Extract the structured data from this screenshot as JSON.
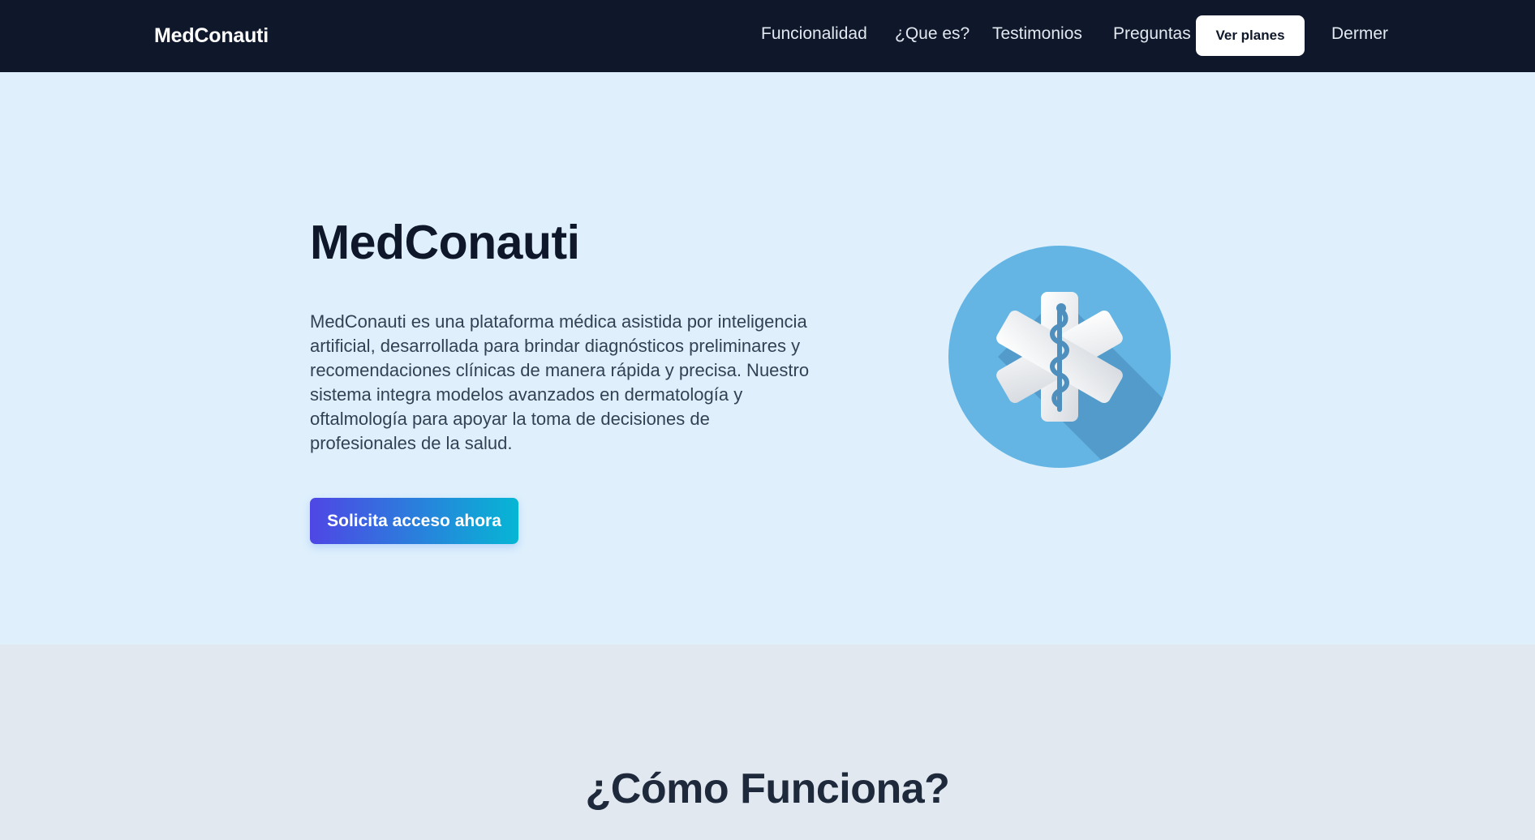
{
  "nav": {
    "brand": "MedConauti",
    "links": [
      "Funcionalidad",
      "¿Que es?",
      "Testimonios",
      "Preguntas"
    ],
    "cta_label": "Ver planes",
    "extra_link": "Dermer"
  },
  "hero": {
    "title": "MedConauti",
    "description": "MedConauti es una plataforma médica asistida por inteligencia artificial, desarrollada para brindar diagnósticos preliminares y recomendaciones clínicas de manera rápida y precisa. Nuestro sistema integra modelos avanzados en dermatología y oftalmología para apoyar la toma de decisiones de profesionales de la salud.",
    "cta_label": "Solicita acceso ahora",
    "logo_icon": "medical-star-of-life-icon"
  },
  "how": {
    "title": "¿Cómo Funciona?"
  },
  "colors": {
    "navbar_bg": "#0f172a",
    "hero_bg": "#dff0fc",
    "section_bg": "#e2e8f0",
    "cta_gradient_start": "#4f46e5",
    "cta_gradient_end": "#06b6d4",
    "logo_circle": "#64b5e4"
  }
}
